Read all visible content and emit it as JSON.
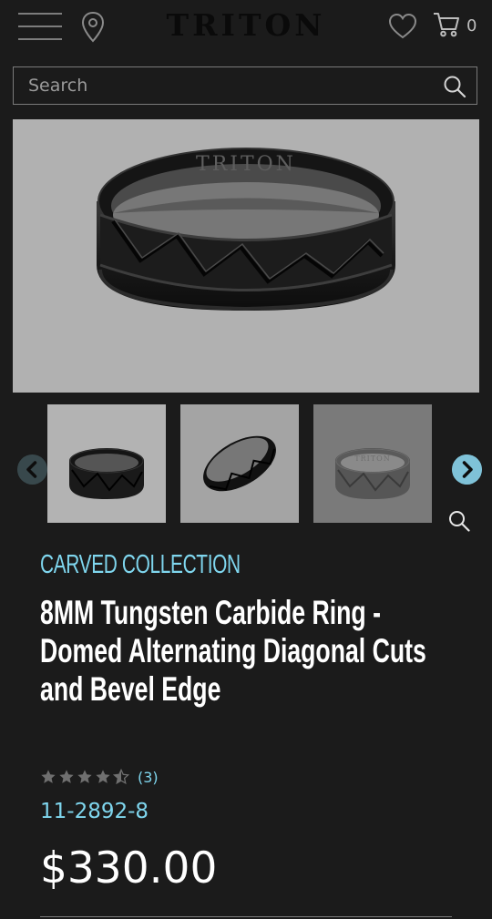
{
  "header": {
    "logo": "TRITON",
    "cart_count": "0"
  },
  "search": {
    "placeholder": "Search"
  },
  "product": {
    "collection": "CARVED COLLECTION",
    "title": "8MM Tungsten Carbide Ring - Domed Alternating Diagonal Cuts and Bevel Edge",
    "rating": 4.5,
    "rating_max": 5,
    "review_count": "(3)",
    "sku": "11-2892-8",
    "price": "$330.00",
    "ring_engraving": "TRITON"
  },
  "gallery": {
    "thumbnail_count": 3,
    "selected_index": 0
  },
  "icons": [
    "hamburger-menu-icon",
    "location-pin-icon",
    "heart-icon",
    "cart-icon",
    "search-icon",
    "chevron-left-icon",
    "chevron-right-icon",
    "zoom-icon",
    "star-icon"
  ],
  "colors": {
    "background": "#1b1b1b",
    "accent": "#7fd6ee",
    "next_arrow": "#7fc2d8",
    "prev_arrow": "#38484c",
    "image_bg": "#b1b1b1"
  }
}
